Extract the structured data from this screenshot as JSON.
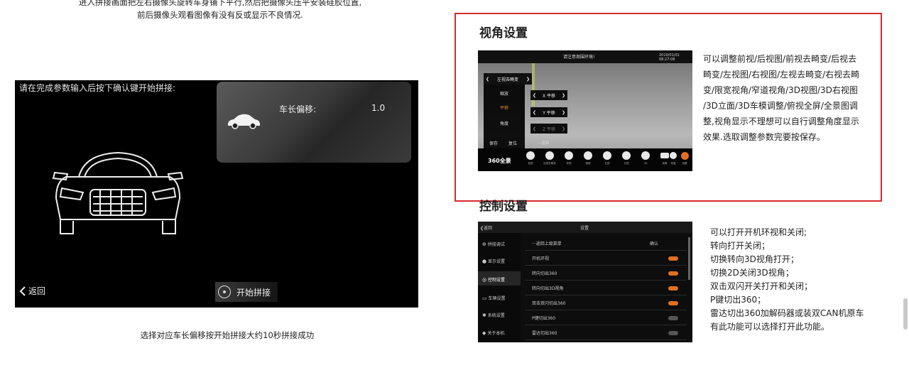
{
  "top": {
    "line1": "进入拼接画面把左右摄像头旋转车身铺下平行,然后把摄像头压平安装硅胶位置,",
    "line2": "前后摄像头观看图像有没有反或显示不良情况."
  },
  "stitch_screen": {
    "prompt": "请在完成参数输入后按下确认键开始拼接:",
    "offset_label": "车长偏移:",
    "offset_value": "1.0",
    "back_label": "返回",
    "start_label": "开始拼接"
  },
  "caption1": "选择对应车长偏移按开始拼接大约10秒拼接成功",
  "view": {
    "heading": "视角设置",
    "screen": {
      "title": "请注意周围环境!",
      "time": "2019/01/01  08:27:08",
      "selected": "左视去畸变",
      "menu": [
        "缩放",
        "平移",
        "角度"
      ],
      "save": "保存",
      "reset": "复位",
      "sub": [
        "X 平移",
        "Y 平移",
        "Z 平移"
      ],
      "back": "···返回",
      "logo": "360全景",
      "icons": [
        "前视",
        "后视去畸变",
        "环视",
        "侧视",
        "左视",
        "右视",
        "3D",
        "录像",
        "亮度",
        "设置"
      ]
    },
    "desc": [
      "可以调整前视/后视图/前视去畸变/后视去",
      "畸变/左视图/右视图/左视去畸变/右视去畸",
      "变/限宽视角/窄道视角/3D视图/3D右视图",
      "/3D立面/3D车模调整/俯视全屏/全景图调",
      "整,视角显示不理想可以自行调整角度显示",
      "效果.选取调整参数完要按保存。"
    ]
  },
  "control": {
    "heading": "控制设置",
    "screen": {
      "back": "返回",
      "title": "设置",
      "side": [
        "拼接调试",
        "显示设置",
        "控制设置",
        "车辆设置",
        "系统设置",
        "关于本机"
      ],
      "rows": [
        {
          "label": "···返回上级菜单",
          "right": "确认"
        },
        {
          "label": "开机环视",
          "on": true
        },
        {
          "label": "转向切出360",
          "on": true
        },
        {
          "label": "转向切出3D视角",
          "on": true
        },
        {
          "label": "双击双闪切出360",
          "on": true
        },
        {
          "label": "P键切出360",
          "on": false
        },
        {
          "label": "雷达切出360",
          "on": false
        }
      ]
    },
    "desc": [
      "可以打开开机环视和关闭;",
      "转向打开关闭；",
      "切换转向3D视角打开；",
      "切换2D关闭3D视角；",
      "双击双闪开关打开和关闭；",
      "P键切出360；",
      "雷达切出360加解码器或装双CAN机原车",
      "有此功能可以选择打开此功能。"
    ]
  },
  "colors": {
    "highlight": "#d92a2a",
    "toggle_on": "#e07020"
  }
}
